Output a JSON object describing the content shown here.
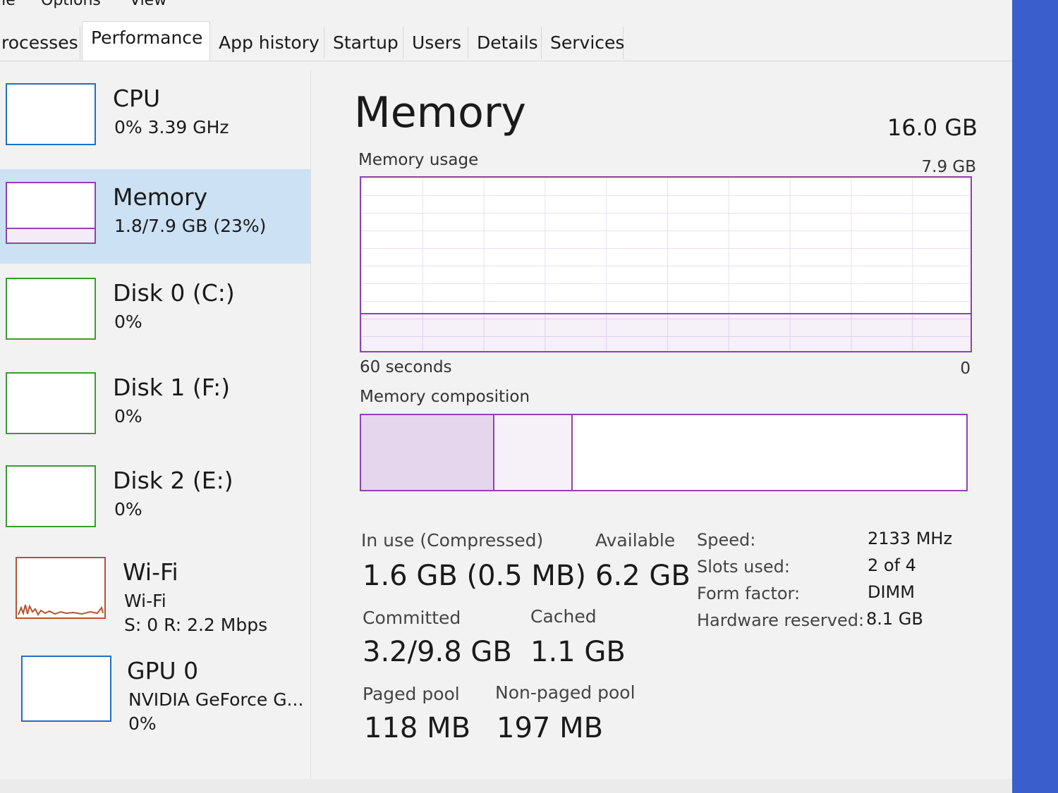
{
  "menu": [
    "ile",
    "Options",
    "View"
  ],
  "tabs": [
    {
      "label": "rocesses"
    },
    {
      "label": "Performance",
      "active": true
    },
    {
      "label": "App history"
    },
    {
      "label": "Startup"
    },
    {
      "label": "Users"
    },
    {
      "label": "Details"
    },
    {
      "label": "Services"
    }
  ],
  "sidebar": {
    "items": [
      {
        "title": "CPU",
        "sub": "0% 3.39 GHz"
      },
      {
        "title": "Memory",
        "sub": "1.8/7.9 GB (23%)",
        "selected": true,
        "usage_fraction": 0.23
      },
      {
        "title": "Disk 0 (C:)",
        "sub": "0%"
      },
      {
        "title": "Disk 1 (F:)",
        "sub": "0%"
      },
      {
        "title": "Disk 2 (E:)",
        "sub": "0%"
      },
      {
        "title": "Wi-Fi",
        "sub": "Wi-Fi",
        "sub2": "S: 0 R: 2.2 Mbps"
      },
      {
        "title": "GPU 0",
        "sub": "NVIDIA GeForce G...",
        "sub2": "0%"
      }
    ]
  },
  "main": {
    "title": "Memory",
    "total": "16.0 GB",
    "usage_label": "Memory usage",
    "usage_max": "7.9 GB",
    "graph_left": "60 seconds",
    "graph_right": "0",
    "usage_fraction": 0.21,
    "composition_label": "Memory composition",
    "composition": {
      "in_use_fraction": 0.22,
      "standby_fraction": 0.13
    },
    "stats": {
      "in_use_label": "In use (Compressed)",
      "in_use_value": "1.6 GB (0.5 MB)",
      "available_label": "Available",
      "available_value": "6.2 GB",
      "committed_label": "Committed",
      "committed_value": "3.2/9.8 GB",
      "cached_label": "Cached",
      "cached_value": "1.1 GB",
      "paged_label": "Paged pool",
      "paged_value": "118 MB",
      "nonpaged_label": "Non-paged pool",
      "nonpaged_value": "197 MB"
    },
    "details": [
      {
        "label": "Speed:",
        "value": "2133 MHz"
      },
      {
        "label": "Slots used:",
        "value": "2 of 4"
      },
      {
        "label": "Form factor:",
        "value": "DIMM"
      },
      {
        "label": "Hardware reserved:",
        "value": "8.1 GB"
      }
    ]
  },
  "colors": {
    "memory_accent": "#8e44ad",
    "cpu_accent": "#1e6fc8",
    "disk_accent": "#3c9a33",
    "wifi_accent": "#b3552f",
    "selected_bg": "#cce1f3"
  }
}
